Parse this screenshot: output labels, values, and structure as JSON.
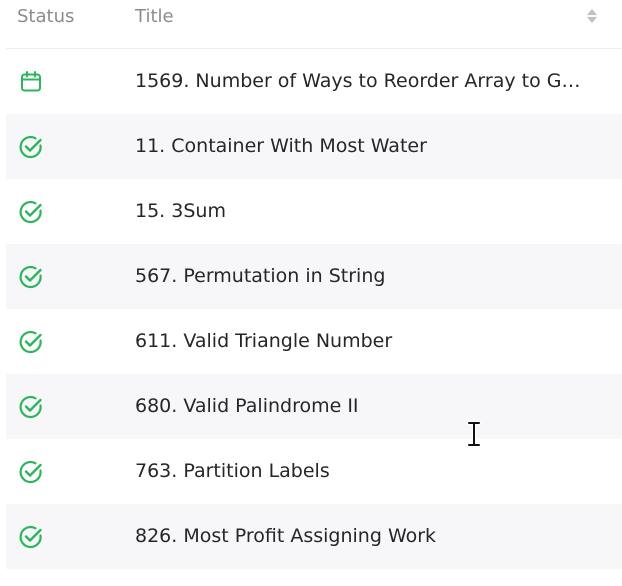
{
  "header": {
    "status_label": "Status",
    "title_label": "Title"
  },
  "colors": {
    "accent_green": "#2db55d",
    "header_text": "#8c8c8c",
    "row_alt_bg": "#f7f7fa"
  },
  "rows": [
    {
      "status": "calendar-icon",
      "title": "1569. Number of Ways to Reorder Array to Get..."
    },
    {
      "status": "check-circle-icon",
      "title": "11. Container With Most Water"
    },
    {
      "status": "check-circle-icon",
      "title": "15. 3Sum"
    },
    {
      "status": "check-circle-icon",
      "title": "567. Permutation in String"
    },
    {
      "status": "check-circle-icon",
      "title": "611. Valid Triangle Number"
    },
    {
      "status": "check-circle-icon",
      "title": "680. Valid Palindrome II"
    },
    {
      "status": "check-circle-icon",
      "title": "763. Partition Labels"
    },
    {
      "status": "check-circle-icon",
      "title": "826. Most Profit Assigning Work"
    }
  ]
}
